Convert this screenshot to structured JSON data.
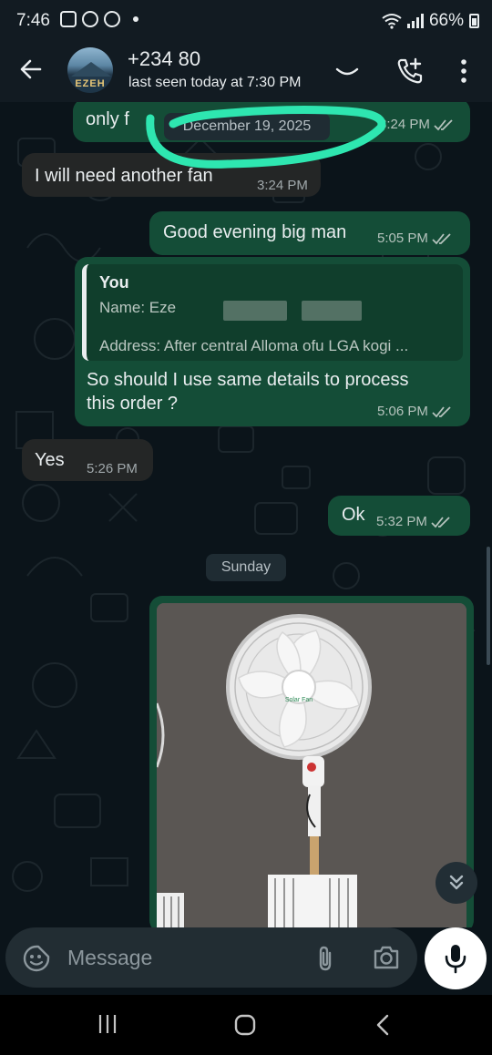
{
  "status_bar": {
    "time": "7:46",
    "battery": "66%"
  },
  "header": {
    "contact_name": "+234 80",
    "last_seen": "last seen today at 7:30 PM",
    "avatar_label": "EZEH"
  },
  "chat": {
    "date_divider": "December 19, 2025",
    "messages": [
      {
        "direction": "out",
        "text": "only f",
        "time": "3:24 PM",
        "ticks": "read"
      },
      {
        "direction": "in",
        "text": "I will need another fan",
        "time": "3:24 PM"
      },
      {
        "direction": "out",
        "text": "Good evening big man",
        "time": "5:05 PM",
        "ticks": "read"
      },
      {
        "direction": "out",
        "quote_author": "You",
        "quote_line1": "Name: Eze",
        "quote_line2": "Address: After central Alloma ofu LGA kogi ...",
        "text_line1": "So should I use same details to process",
        "text_line2": "this order ?",
        "time": "5:06 PM",
        "ticks": "read"
      },
      {
        "direction": "in",
        "text": "Yes",
        "time": "5:26 PM"
      },
      {
        "direction": "out",
        "text": "Ok",
        "time": "5:32 PM",
        "ticks": "read"
      }
    ],
    "day_divider": "Sunday",
    "image_message": {
      "fan_label": "Solar Fan"
    }
  },
  "composer": {
    "placeholder": "Message"
  },
  "colors": {
    "outgoing_bubble": "#144d37",
    "incoming_bubble": "#242626",
    "chat_background": "#0b141a",
    "read_ticks": "#b5c3bd",
    "annotation": "#2ee6b0"
  }
}
